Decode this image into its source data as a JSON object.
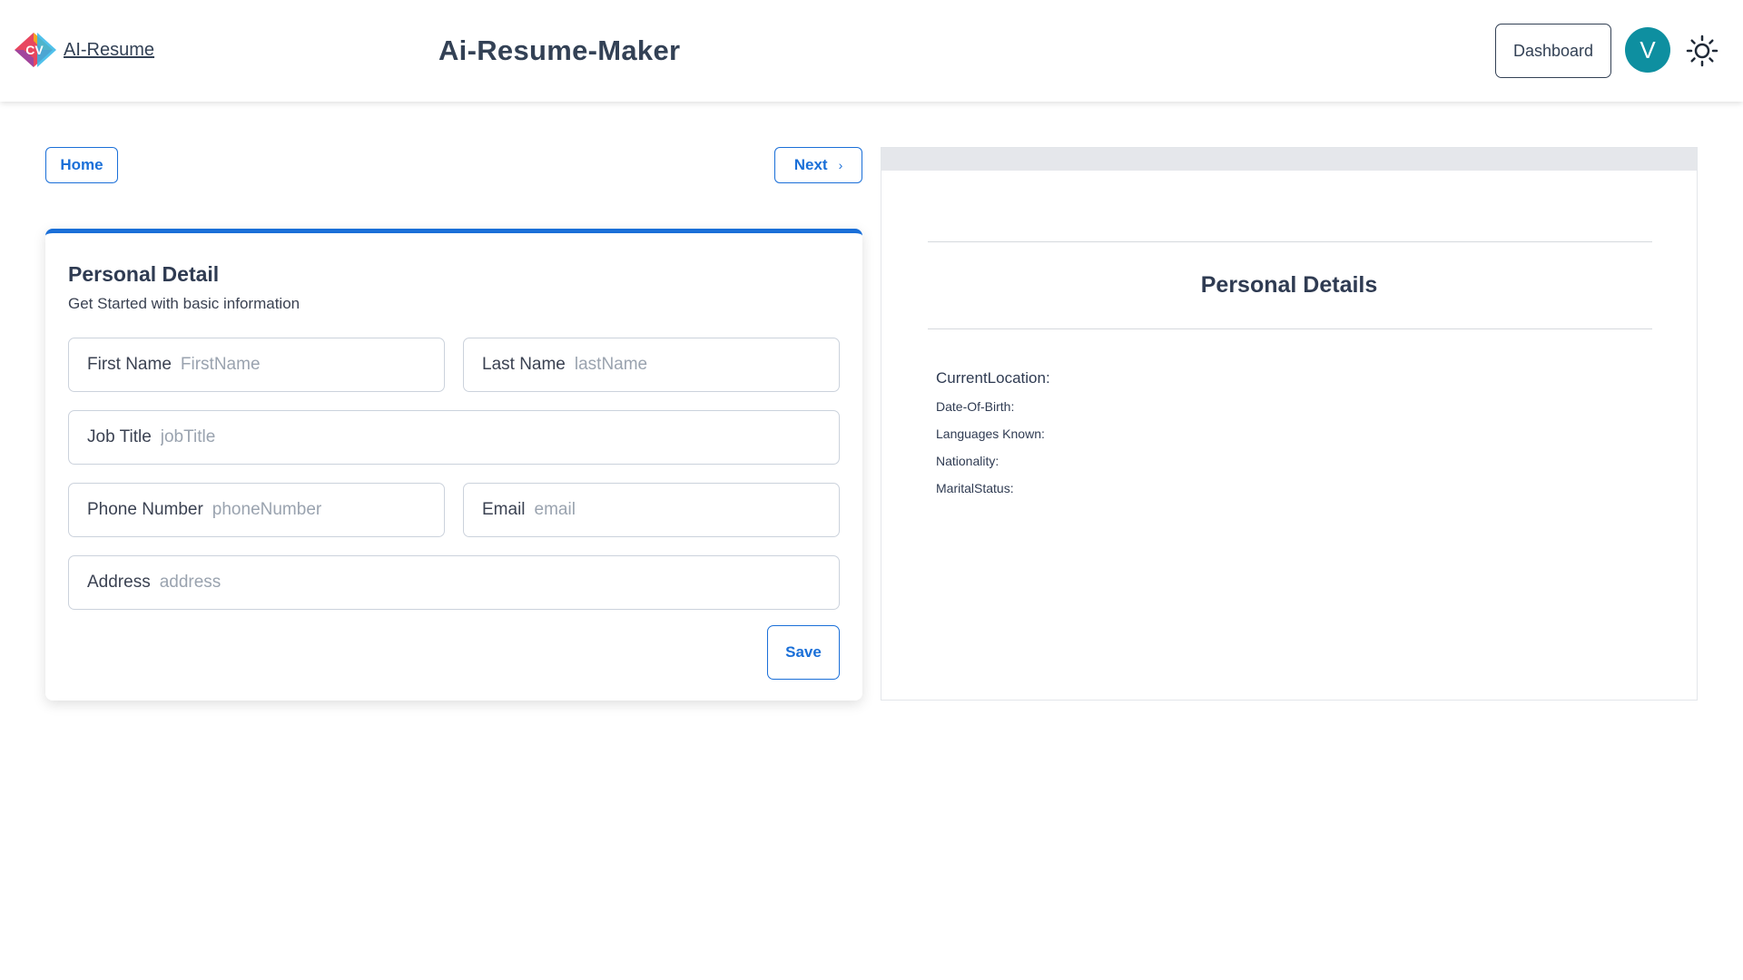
{
  "header": {
    "logo_badge": "CV",
    "logo_text": "AI-Resume",
    "title": "Ai-Resume-Maker",
    "dashboard_label": "Dashboard",
    "avatar_initial": "V"
  },
  "nav": {
    "home_label": "Home",
    "next_label": "Next",
    "next_chevron": "›"
  },
  "form": {
    "title": "Personal Detail",
    "subtitle": "Get Started with basic information",
    "fields": {
      "first_name": {
        "label": "First Name",
        "placeholder": "FirstName"
      },
      "last_name": {
        "label": "Last Name",
        "placeholder": "lastName"
      },
      "job_title": {
        "label": "Job Title",
        "placeholder": "jobTitle"
      },
      "phone": {
        "label": "Phone Number",
        "placeholder": "phoneNumber"
      },
      "email": {
        "label": "Email",
        "placeholder": "email"
      },
      "address": {
        "label": "Address",
        "placeholder": "address"
      }
    },
    "save_label": "Save"
  },
  "preview": {
    "heading": "Personal Details",
    "current_location": "CurrentLocation:",
    "date_of_birth": "Date-Of-Birth:",
    "languages_known": "Languages Known:",
    "nationality": "Nationality:",
    "marital_status": "MaritalStatus:"
  },
  "colors": {
    "accent": "#1a6fd8",
    "avatar_bg": "#0e8fa0",
    "text_dark": "#334155"
  }
}
